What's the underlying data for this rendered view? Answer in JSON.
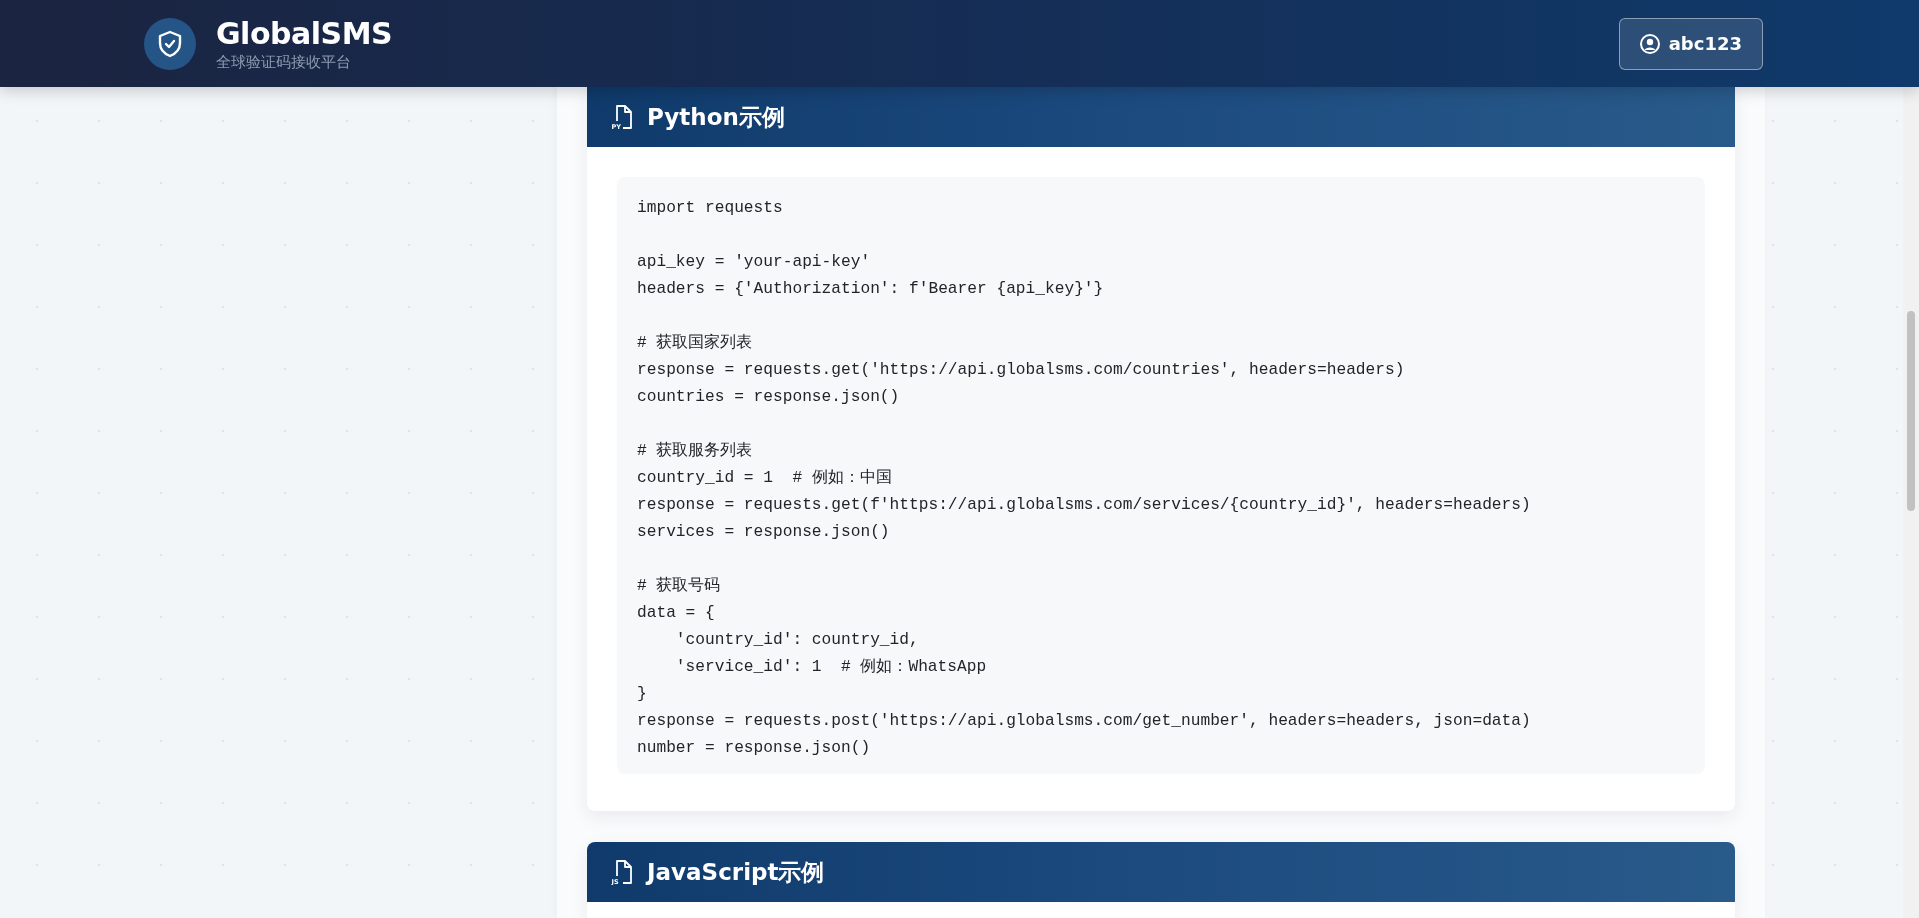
{
  "header": {
    "brand": "GlobalSMS",
    "tagline": "全球验证码接收平台",
    "user_button": "abc123"
  },
  "cards": [
    {
      "icon_label": "PY",
      "title": "Python示例",
      "code": "import requests\n\napi_key = 'your-api-key'\nheaders = {'Authorization': f'Bearer {api_key}'}\n\n# 获取国家列表\nresponse = requests.get('https://api.globalsms.com/countries', headers=headers)\ncountries = response.json()\n\n# 获取服务列表\ncountry_id = 1  # 例如：中国\nresponse = requests.get(f'https://api.globalsms.com/services/{country_id}', headers=headers)\nservices = response.json()\n\n# 获取号码\ndata = {\n    'country_id': country_id,\n    'service_id': 1  # 例如：WhatsApp\n}\nresponse = requests.post('https://api.globalsms.com/get_number', headers=headers, json=data)\nnumber = response.json()"
    },
    {
      "icon_label": "JS",
      "title": "JavaScript示例"
    }
  ]
}
